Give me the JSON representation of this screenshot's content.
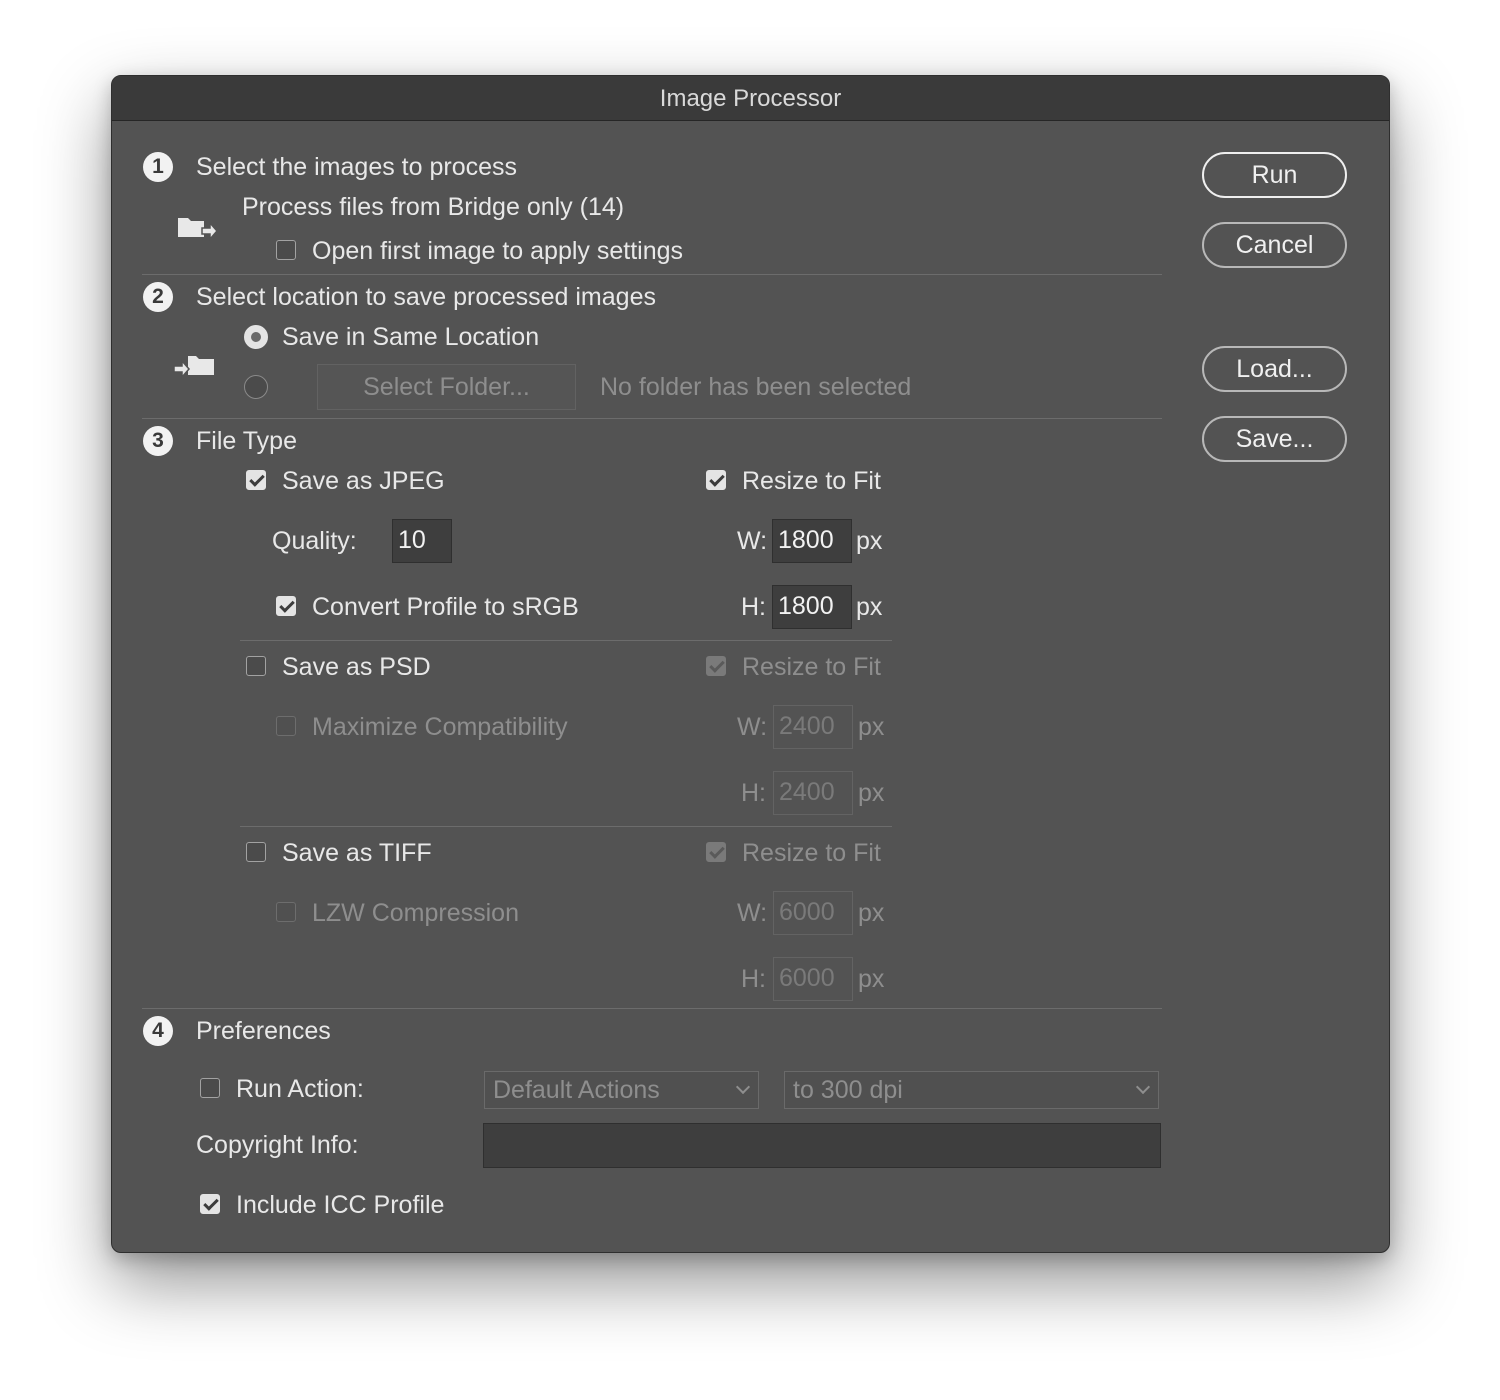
{
  "window": {
    "title": "Image Processor"
  },
  "buttons": {
    "run": "Run",
    "cancel": "Cancel",
    "load": "Load...",
    "save": "Save..."
  },
  "section1": {
    "number": "1",
    "title": "Select the images to process",
    "source_label": "Process files from Bridge only (14)",
    "open_first_label": "Open first image to apply settings",
    "open_first_checked": false,
    "icon": "folder-arrow-icon"
  },
  "section2": {
    "number": "2",
    "title": "Select location to save processed images",
    "same_location_label": "Save in Same Location",
    "same_location_selected": true,
    "select_folder_label": "Select Folder...",
    "no_folder_text": "No folder has been selected",
    "icon": "folder-save-icon"
  },
  "section3": {
    "number": "3",
    "title": "File Type",
    "jpeg": {
      "label": "Save as JPEG",
      "checked": true,
      "quality_label": "Quality:",
      "quality": "10",
      "convert_label": "Convert Profile to sRGB",
      "convert_checked": true,
      "resize_label": "Resize to Fit",
      "resize_checked": true,
      "w_label": "W:",
      "w": "1800",
      "h_label": "H:",
      "h": "1800",
      "unit": "px"
    },
    "psd": {
      "label": "Save as PSD",
      "checked": false,
      "compat_label": "Maximize Compatibility",
      "compat_checked": false,
      "resize_label": "Resize to Fit",
      "resize_checked": true,
      "w_label": "W:",
      "w": "2400",
      "h_label": "H:",
      "h": "2400",
      "unit": "px"
    },
    "tiff": {
      "label": "Save as TIFF",
      "checked": false,
      "lzw_label": "LZW Compression",
      "lzw_checked": false,
      "resize_label": "Resize to Fit",
      "resize_checked": true,
      "w_label": "W:",
      "w": "6000",
      "h_label": "H:",
      "h": "6000",
      "unit": "px"
    }
  },
  "section4": {
    "number": "4",
    "title": "Preferences",
    "run_action_label": "Run Action:",
    "run_action_checked": false,
    "action_set": "Default Actions",
    "action": "to 300 dpi",
    "copyright_label": "Copyright Info:",
    "copyright_value": "",
    "icc_label": "Include ICC Profile",
    "icc_checked": true
  },
  "colors": {
    "dialog_bg": "#535353",
    "titlebar_bg": "#3a3a3a",
    "text": "#e8e8e8",
    "disabled_text": "#8e8e8e"
  }
}
